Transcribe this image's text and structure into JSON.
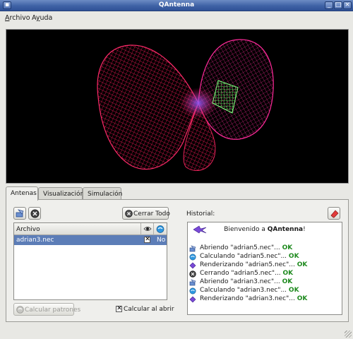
{
  "window": {
    "title": "QAntenna"
  },
  "menubar": [
    {
      "accel": "A",
      "rest": "rchivo"
    },
    {
      "pre": "A",
      "accel": "y",
      "rest": "uda"
    }
  ],
  "tabs": [
    {
      "label": "Antenas",
      "active": true
    },
    {
      "label": "Visualización",
      "active": false
    },
    {
      "label": "Simulación",
      "active": false
    }
  ],
  "antenas": {
    "close_all_label": "Cerrar Todo",
    "table_header": "Archivo",
    "rows": [
      {
        "file": "adrian3.nec",
        "visible_checked": true,
        "calc": "No"
      }
    ],
    "calc_button_label": "Calcular patrones",
    "calc_on_open": {
      "label": "Calcular al abrir",
      "checked": true
    }
  },
  "history": {
    "label": "Historial:",
    "welcome_pre": "Bienvenido a ",
    "welcome_app": "QAntenna",
    "welcome_post": "!",
    "entries": [
      {
        "icon": "open-icon",
        "text": "Abriendo \"adrian5.nec\"...",
        "status": "OK"
      },
      {
        "icon": "calc-icon",
        "text": "Calculando \"adrian5.nec\"...",
        "status": "OK"
      },
      {
        "icon": "render-icon",
        "text": "Renderizando \"adrian5.nec\"...",
        "status": "OK"
      },
      {
        "icon": "close-file-icon",
        "text": "Cerrando \"adrian5.nec\"...",
        "status": "OK"
      },
      {
        "icon": "open-icon",
        "text": "Abriendo \"adrian3.nec\"...",
        "status": "OK"
      },
      {
        "icon": "calc-icon",
        "text": "Calculando \"adrian3.nec\"...",
        "status": "OK"
      },
      {
        "icon": "render-icon",
        "text": "Renderizando \"adrian3.nec\"...",
        "status": "OK"
      }
    ]
  },
  "colors": {
    "selection": "#5c7db7",
    "ok": "#1e8a1e",
    "titlebar": "#3f62a5"
  }
}
